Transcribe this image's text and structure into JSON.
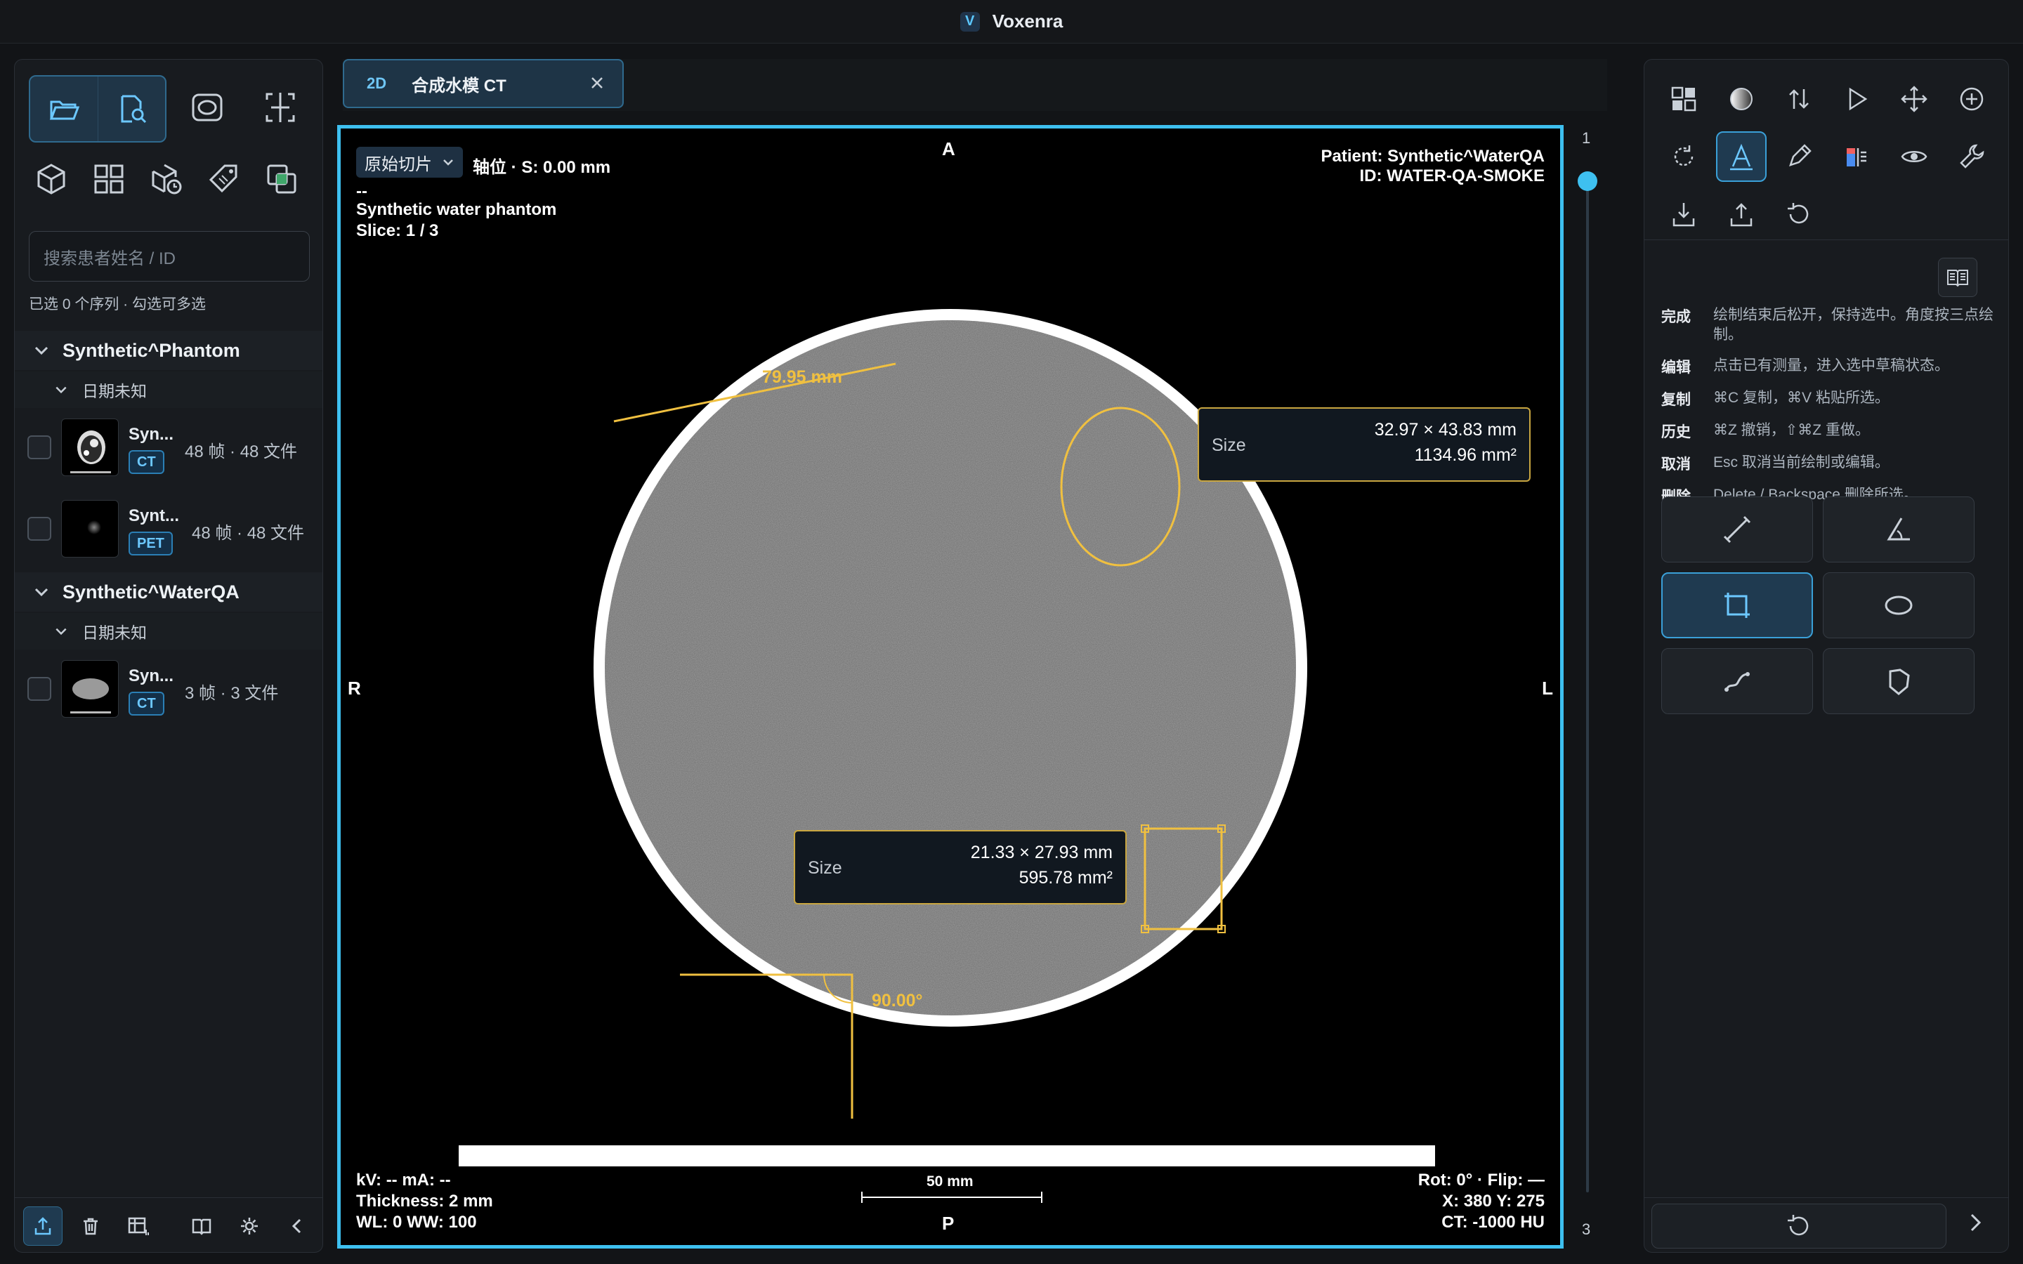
{
  "app": {
    "title": "Voxenra",
    "logo_letter": "V"
  },
  "left_panel": {
    "search_placeholder": "搜索患者姓名 / ID",
    "selection_info": "已选 0 个序列 · 勾选可多选",
    "patients": [
      {
        "name": "Synthetic^Phantom",
        "date_group": "日期未知",
        "series": [
          {
            "name": "Syn...",
            "modality": "CT",
            "count": "48 帧 · 48 文件"
          },
          {
            "name": "Synt...",
            "modality": "PET",
            "count": "48 帧 · 48 文件"
          }
        ]
      },
      {
        "name": "Synthetic^WaterQA",
        "date_group": "日期未知",
        "series": [
          {
            "name": "Syn...",
            "modality": "CT",
            "count": "3 帧 · 3 文件"
          }
        ]
      }
    ]
  },
  "tab": {
    "mode": "2D",
    "name": "合成水模 CT"
  },
  "viewport": {
    "slice_select": "原始切片",
    "orientation_info": "轴位 · S: 0.00 mm",
    "line1": "--",
    "series_desc": "Synthetic water phantom",
    "slice": "Slice: 1 / 3",
    "patient": "Patient: Synthetic^WaterQA",
    "patient_id": "ID: WATER-QA-SMOKE",
    "orient": {
      "top": "A",
      "bottom": "P",
      "left": "R",
      "right": "L"
    },
    "kv_ma": "kV: --   mA: --",
    "thickness": "Thickness: 2 mm",
    "wl_ww": "WL: 0   WW: 100",
    "rot_flip": "Rot: 0° · Flip: —",
    "xy": "X: 380   Y: 275",
    "ct": "CT: -1000 HU",
    "scale": "50 mm",
    "measurements": {
      "line_label": "79.95 mm",
      "angle_label": "90.00°",
      "ellipse_size_label": "Size",
      "ellipse_dims": "32.97 × 43.83 mm",
      "ellipse_area": "1134.96 mm²",
      "rect_size_label": "Size",
      "rect_dims": "21.33 × 27.93 mm",
      "rect_area": "595.78 mm²"
    }
  },
  "slice_slider": {
    "min": "1",
    "max": "3",
    "position_fraction": 0.0
  },
  "right_panel": {
    "help": [
      {
        "k": "完成",
        "v": "绘制结束后松开，保持选中。角度按三点绘制。"
      },
      {
        "k": "编辑",
        "v": "点击已有测量，进入选中草稿状态。"
      },
      {
        "k": "复制",
        "v": "⌘C 复制，⌘V 粘贴所选。"
      },
      {
        "k": "历史",
        "v": "⌘Z 撤销，⇧⌘Z 重做。"
      },
      {
        "k": "取消",
        "v": "Esc 取消当前绘制或编辑。"
      },
      {
        "k": "删除",
        "v": "Delete / Backspace 删除所选。"
      }
    ]
  },
  "colors": {
    "accent": "#3ec0f0",
    "measure": "#f0c040"
  }
}
